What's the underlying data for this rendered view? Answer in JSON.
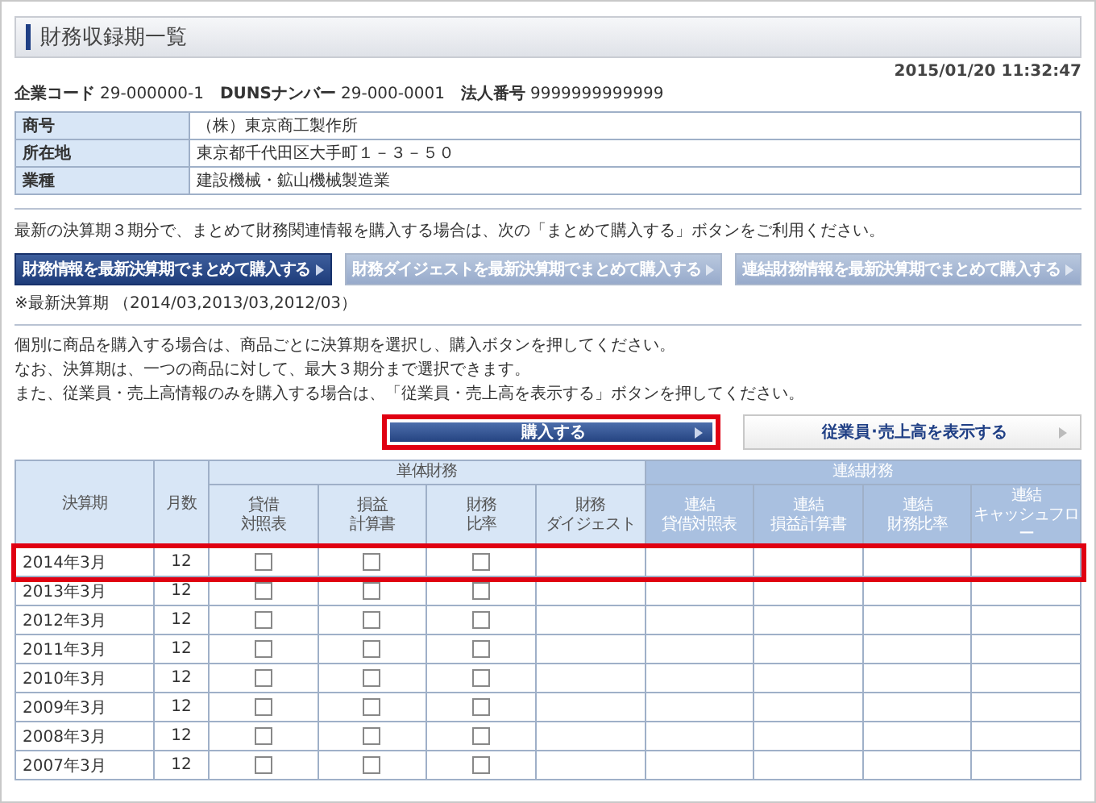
{
  "page_title": "財務収録期一覧",
  "timestamp": "2015/01/20 11:32:47",
  "company_ids": [
    {
      "label": "企業コード",
      "value": "29-000000-1"
    },
    {
      "label": "DUNSナンバー",
      "value": "29-000-0001"
    },
    {
      "label": "法人番号",
      "value": "9999999999999"
    }
  ],
  "company_info": [
    {
      "label": "商号",
      "value": "（株）東京商工製作所"
    },
    {
      "label": "所在地",
      "value": "東京都千代田区大手町１－３－５０"
    },
    {
      "label": "業種",
      "value": "建設機械・鉱山機械製造業"
    }
  ],
  "bulk_intro": "最新の決算期３期分で、まとめて財務関連情報を購入する場合は、次の「まとめて購入する」ボタンをご利用ください。",
  "bulk_buttons": [
    {
      "label": "財務情報を最新決算期でまとめて購入する",
      "disabled": false
    },
    {
      "label": "財務ダイジェストを最新決算期でまとめて購入する",
      "disabled": true
    },
    {
      "label": "連結財務情報を最新決算期でまとめて購入する",
      "disabled": true
    }
  ],
  "latest_note": "※最新決算期 （2014/03,2013/03,2012/03）",
  "instructions": [
    "個別に商品を購入する場合は、商品ごとに決算期を選択し、購入ボタンを押してください。",
    "なお、決算期は、一つの商品に対して、最大３期分まで選択できます。",
    "また、従業員・売上高情報のみを購入する場合は、「従業員・売上高を表示する」ボタンを押してください。"
  ],
  "action_buttons": [
    {
      "label": "購入する",
      "kind": "primary",
      "highlighted": true
    },
    {
      "label": "従業員･売上高を表示する",
      "kind": "secondary",
      "highlighted": false
    }
  ],
  "table": {
    "period_header": "決算期",
    "months_header": "月数",
    "groups": [
      {
        "label": "単体財務",
        "kind": "single",
        "columns": [
          [
            "貸借",
            "対照表"
          ],
          [
            "損益",
            "計算書"
          ],
          [
            "財務",
            "比率"
          ],
          [
            "財務",
            "ダイジェスト"
          ]
        ]
      },
      {
        "label": "連結財務",
        "kind": "consolidated",
        "columns": [
          [
            "連結",
            "貸借対照表"
          ],
          [
            "連結",
            "損益計算書"
          ],
          [
            "連結",
            "財務比率"
          ],
          [
            "連結",
            "キャッシュフロー"
          ]
        ]
      }
    ],
    "rows": [
      {
        "period": "2014年3月",
        "months": "12",
        "highlighted": true,
        "checks": [
          false,
          false,
          false
        ]
      },
      {
        "period": "2013年3月",
        "months": "12",
        "highlighted": false,
        "checks": [
          false,
          false,
          false
        ]
      },
      {
        "period": "2012年3月",
        "months": "12",
        "highlighted": false,
        "checks": [
          false,
          false,
          false
        ]
      },
      {
        "period": "2011年3月",
        "months": "12",
        "highlighted": false,
        "checks": [
          false,
          false,
          false
        ]
      },
      {
        "period": "2010年3月",
        "months": "12",
        "highlighted": false,
        "checks": [
          false,
          false,
          false
        ]
      },
      {
        "period": "2009年3月",
        "months": "12",
        "highlighted": false,
        "checks": [
          false,
          false,
          false
        ]
      },
      {
        "period": "2008年3月",
        "months": "12",
        "highlighted": false,
        "checks": [
          false,
          false,
          false
        ]
      },
      {
        "period": "2007年3月",
        "months": "12",
        "highlighted": false,
        "checks": [
          false,
          false,
          false
        ]
      }
    ]
  }
}
